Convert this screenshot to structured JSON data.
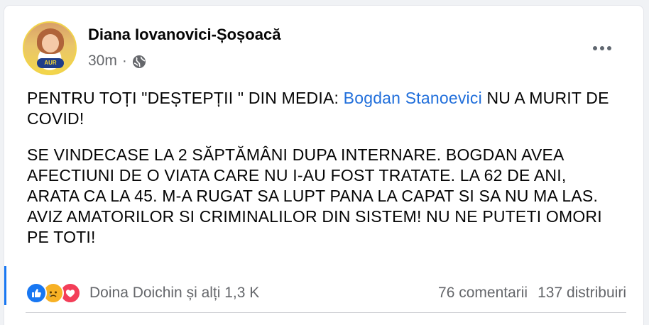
{
  "post": {
    "author": "Diana Iovanovici-Șoșoacă",
    "time": "30m",
    "separator": "·",
    "privacy_icon": "globe-icon",
    "menu_icon": "more-options-icon",
    "avatar_badge": "AUR",
    "text": {
      "p1_before": "PENTRU TOȚI \"DEȘTEPȚII \" DIN MEDIA: ",
      "p1_mention": "Bogdan Stanoevici",
      "p1_after": " NU A MURIT DE COVID!",
      "p2": "SE VINDECASE LA 2 SĂPTĂMÂNI DUPA INTERNARE. BOGDAN AVEA AFECTIUNI DE O VIATA CARE NU I-AU FOST TRATATE. LA 62 DE ANI, ARATA CA LA 45. M-A RUGAT SA LUPT PANA LA CAPAT SI SA NU MA LAS. AVIZ AMATORILOR SI CRIMINALILOR DIN SISTEM! NU NE PUTETI OMORI PE TOTI!"
    }
  },
  "footer": {
    "reactions": [
      "like-icon",
      "sad-icon",
      "love-icon"
    ],
    "reactors": "Doina Doichin și alți 1,3 K",
    "comments": "76 comentarii",
    "shares": "137 distribuiri"
  },
  "colors": {
    "link": "#216fdb",
    "like": "#1877f2",
    "sad": "#f7b125",
    "love": "#f33e58",
    "secondary_text": "#65676b"
  }
}
